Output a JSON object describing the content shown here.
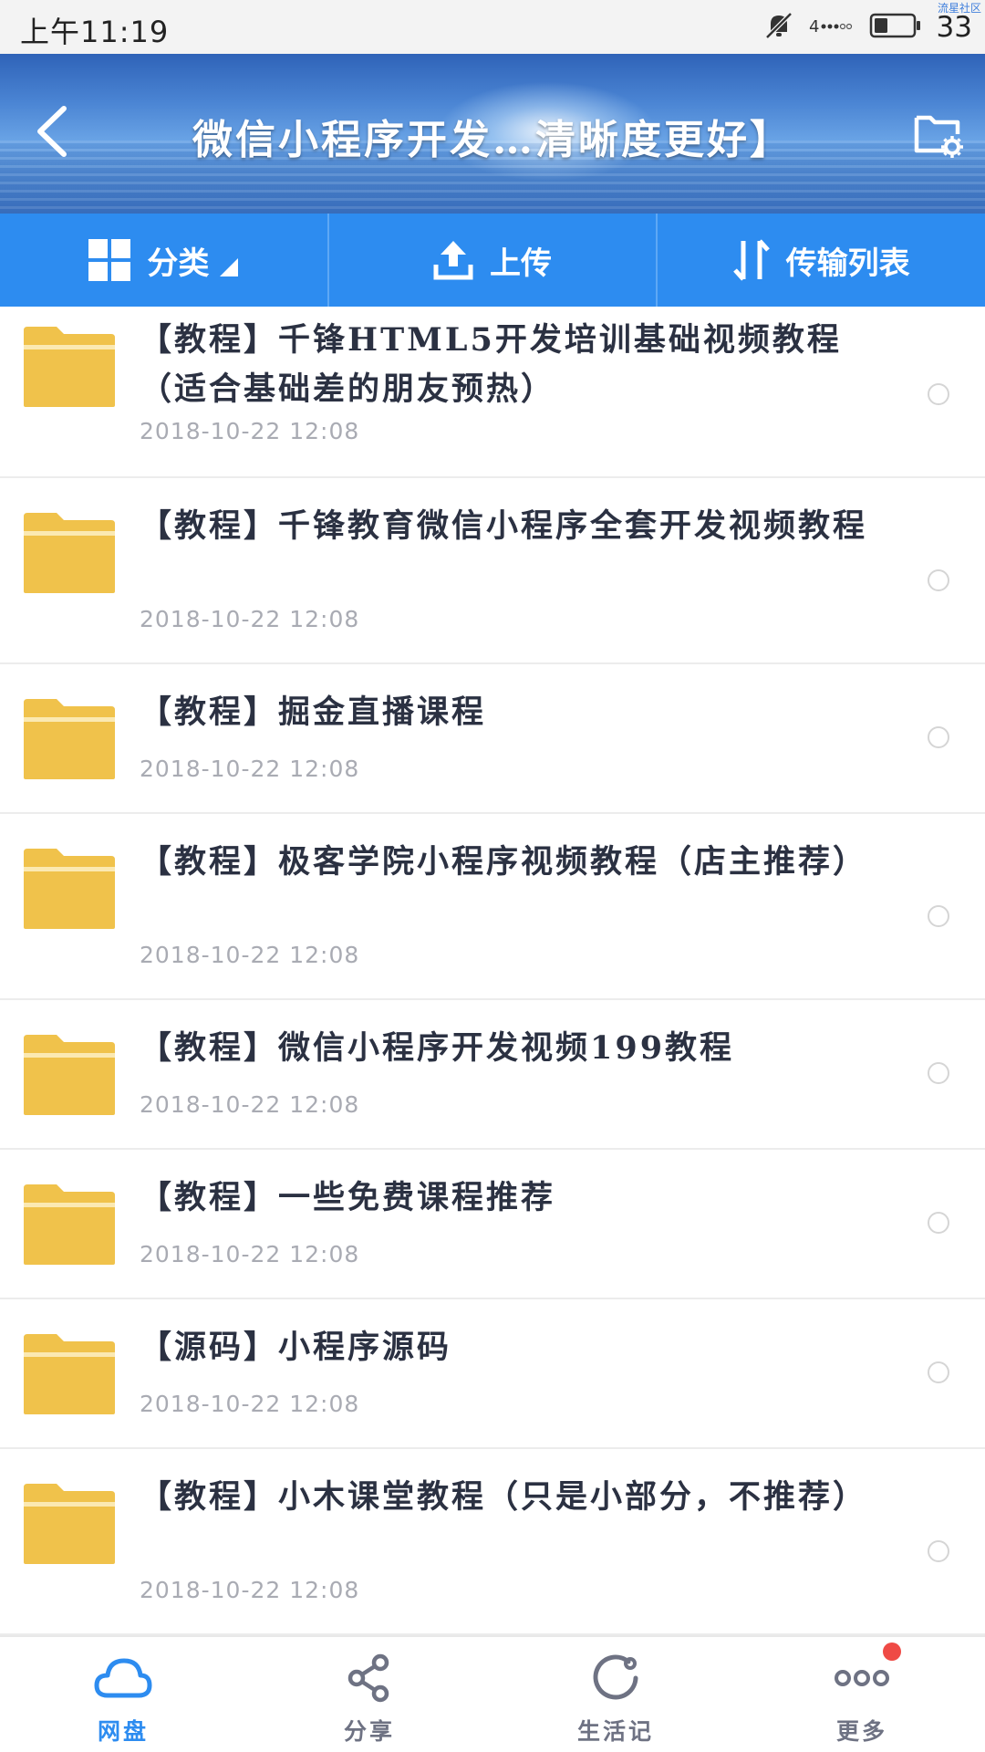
{
  "status_bar": {
    "time": "上午11:19",
    "battery_level": "33",
    "watermark": "流星社区",
    "icons": [
      "mute-icon",
      "signal-icon",
      "battery-icon"
    ]
  },
  "header": {
    "title": "微信小程序开发…清晰度更好】",
    "back_icon": "chevron-left-icon",
    "settings_icon": "folder-settings-icon"
  },
  "toolbar": {
    "category_label": "分类",
    "upload_label": "上传",
    "transfer_label": "传输列表"
  },
  "files": [
    {
      "name": "【教程】千锋HTML5开发培训基础视频教程（适合基础差的朋友预热）",
      "date": "2018-10-22  12:08"
    },
    {
      "name": "【教程】千锋教育微信小程序全套开发视频教程",
      "date": "2018-10-22  12:08"
    },
    {
      "name": "【教程】掘金直播课程",
      "date": "2018-10-22  12:08"
    },
    {
      "name": "【教程】极客学院小程序视频教程（店主推荐）",
      "date": "2018-10-22  12:08"
    },
    {
      "name": "【教程】微信小程序开发视频199教程",
      "date": "2018-10-22  12:08"
    },
    {
      "name": "【教程】一些免费课程推荐",
      "date": "2018-10-22  12:08"
    },
    {
      "name": "【源码】小程序源码",
      "date": "2018-10-22  12:08"
    },
    {
      "name": "【教程】小木课堂教程（只是小部分，不推荐）",
      "date": "2018-10-22  12:08"
    }
  ],
  "bottom_nav": [
    {
      "label": "网盘",
      "icon": "cloud-icon",
      "active": true
    },
    {
      "label": "分享",
      "icon": "share-icon",
      "active": false
    },
    {
      "label": "生活记",
      "icon": "circle-refresh-icon",
      "active": false
    },
    {
      "label": "更多",
      "icon": "more-dots-icon",
      "active": false,
      "badge": true
    }
  ],
  "colors": {
    "accent": "#2d8cf0",
    "folder": "#f0c24b",
    "title_text": "#2b3142",
    "date_text": "#a9abb3",
    "badge": "#ef4a45"
  }
}
